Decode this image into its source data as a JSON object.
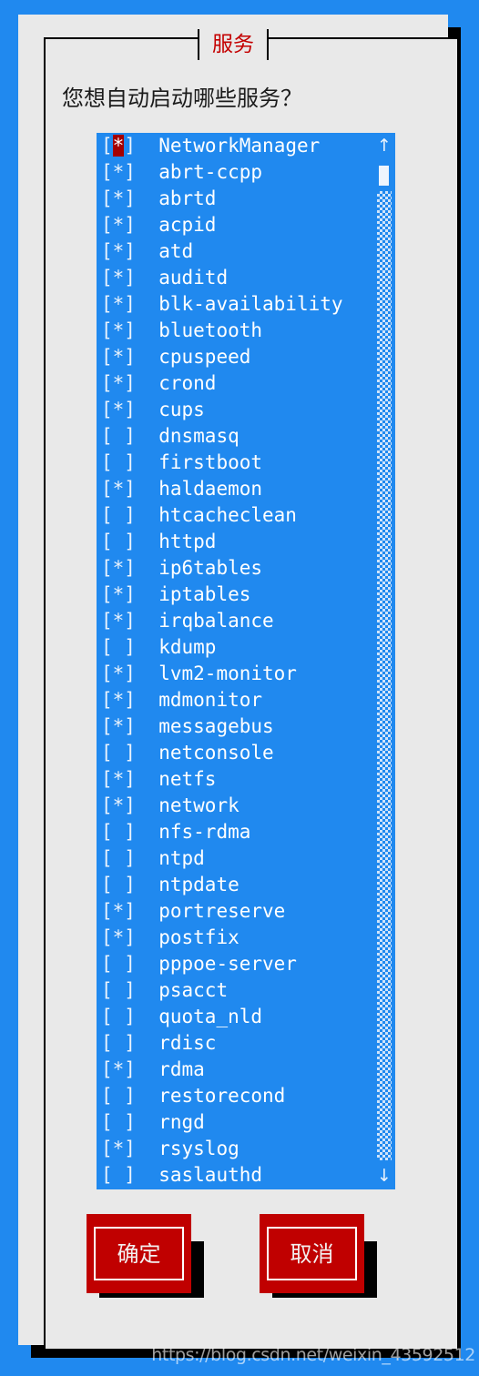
{
  "screen": {
    "background_color": "#2089ef"
  },
  "dialog": {
    "title": "服务",
    "title_color": "#c40000",
    "background_color": "#e9e9e9",
    "prompt": "您想自动启动哪些服务？"
  },
  "service_list": {
    "background_color": "#2089ef",
    "text_color": "#ffffff",
    "cursor_color": "#a40000",
    "cursor_index": 0,
    "scrollbar": {
      "up_arrow": "↑",
      "down_arrow": "↓"
    },
    "items": [
      {
        "checked": true,
        "box": "[*]",
        "label": "NetworkManager"
      },
      {
        "checked": true,
        "box": "[*]",
        "label": "abrt-ccpp"
      },
      {
        "checked": true,
        "box": "[*]",
        "label": "abrtd"
      },
      {
        "checked": true,
        "box": "[*]",
        "label": "acpid"
      },
      {
        "checked": true,
        "box": "[*]",
        "label": "atd"
      },
      {
        "checked": true,
        "box": "[*]",
        "label": "auditd"
      },
      {
        "checked": true,
        "box": "[*]",
        "label": "blk-availability"
      },
      {
        "checked": true,
        "box": "[*]",
        "label": "bluetooth"
      },
      {
        "checked": true,
        "box": "[*]",
        "label": "cpuspeed"
      },
      {
        "checked": true,
        "box": "[*]",
        "label": "crond"
      },
      {
        "checked": true,
        "box": "[*]",
        "label": "cups"
      },
      {
        "checked": false,
        "box": "[ ]",
        "label": "dnsmasq"
      },
      {
        "checked": false,
        "box": "[ ]",
        "label": "firstboot"
      },
      {
        "checked": true,
        "box": "[*]",
        "label": "haldaemon"
      },
      {
        "checked": false,
        "box": "[ ]",
        "label": "htcacheclean"
      },
      {
        "checked": false,
        "box": "[ ]",
        "label": "httpd"
      },
      {
        "checked": true,
        "box": "[*]",
        "label": "ip6tables"
      },
      {
        "checked": true,
        "box": "[*]",
        "label": "iptables"
      },
      {
        "checked": true,
        "box": "[*]",
        "label": "irqbalance"
      },
      {
        "checked": false,
        "box": "[ ]",
        "label": "kdump"
      },
      {
        "checked": true,
        "box": "[*]",
        "label": "lvm2-monitor"
      },
      {
        "checked": true,
        "box": "[*]",
        "label": "mdmonitor"
      },
      {
        "checked": true,
        "box": "[*]",
        "label": "messagebus"
      },
      {
        "checked": false,
        "box": "[ ]",
        "label": "netconsole"
      },
      {
        "checked": true,
        "box": "[*]",
        "label": "netfs"
      },
      {
        "checked": true,
        "box": "[*]",
        "label": "network"
      },
      {
        "checked": false,
        "box": "[ ]",
        "label": "nfs-rdma"
      },
      {
        "checked": false,
        "box": "[ ]",
        "label": "ntpd"
      },
      {
        "checked": false,
        "box": "[ ]",
        "label": "ntpdate"
      },
      {
        "checked": true,
        "box": "[*]",
        "label": "portreserve"
      },
      {
        "checked": true,
        "box": "[*]",
        "label": "postfix"
      },
      {
        "checked": false,
        "box": "[ ]",
        "label": "pppoe-server"
      },
      {
        "checked": false,
        "box": "[ ]",
        "label": "psacct"
      },
      {
        "checked": false,
        "box": "[ ]",
        "label": "quota_nld"
      },
      {
        "checked": false,
        "box": "[ ]",
        "label": "rdisc"
      },
      {
        "checked": true,
        "box": "[*]",
        "label": "rdma"
      },
      {
        "checked": false,
        "box": "[ ]",
        "label": "restorecond"
      },
      {
        "checked": false,
        "box": "[ ]",
        "label": "rngd"
      },
      {
        "checked": true,
        "box": "[*]",
        "label": "rsyslog"
      },
      {
        "checked": false,
        "box": "[ ]",
        "label": "saslauthd"
      }
    ]
  },
  "buttons": {
    "ok_label": "确定",
    "cancel_label": "取消",
    "face_color": "#c00000"
  },
  "watermark": {
    "text": "https://blog.csdn.net/weixin_43592512"
  }
}
